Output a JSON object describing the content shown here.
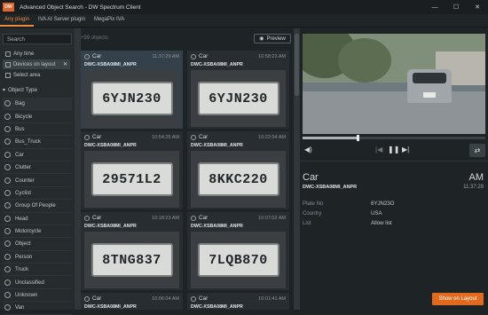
{
  "window": {
    "logo_text": "DW",
    "title": "Advanced Object Search - DW Spectrum Client",
    "controls": [
      "—",
      "☐",
      "✕"
    ]
  },
  "tabs": [
    {
      "label": "Any plugin",
      "active": true
    },
    {
      "label": "IVA AI Server plugin",
      "active": false
    },
    {
      "label": "MegaPix IVA",
      "active": false
    }
  ],
  "left": {
    "search_placeholder": "Search",
    "time_filter": "Any time",
    "camera_filter": "Devices on layout",
    "area_filter": "Select area",
    "section_title": "Object Type",
    "object_types": [
      "Bag",
      "Bicycle",
      "Bus",
      "Bus_Truck",
      "Car",
      "Clutter",
      "Counter",
      "Cyclist",
      "Group Of People",
      "Head",
      "Motorcycle",
      "Object",
      "Person",
      "Truck",
      "Unclassified",
      "Unknown",
      "Van"
    ]
  },
  "middle": {
    "count_text": "+99 objects",
    "preview_label": "Preview",
    "cards": [
      {
        "type": "Car",
        "time": "11:37:29 AM",
        "device": "DWC-XSBA08MI_ANPR",
        "plate": "6YJN230",
        "selected": true
      },
      {
        "type": "Car",
        "time": "10:58:23 AM",
        "device": "DWC-XSBA08MI_ANPR",
        "plate": "6YJN230",
        "selected": false
      },
      {
        "type": "Car",
        "time": "10:54:25 AM",
        "device": "DWC-XSBA08MI_ANPR",
        "plate": "29571L2",
        "selected": false
      },
      {
        "type": "Car",
        "time": "10:22:54 AM",
        "device": "DWC-XSBA08MI_ANPR",
        "plate": "8KKC220",
        "selected": false
      },
      {
        "type": "Car",
        "time": "10:18:23 AM",
        "device": "DWC-XSBA08MI_ANPR",
        "plate": "8TNG837",
        "selected": false
      },
      {
        "type": "Car",
        "time": "10:07:02 AM",
        "device": "DWC-XSBA08MI_ANPR",
        "plate": "7LQB870",
        "selected": false
      },
      {
        "type": "Car",
        "time": "10:06:04 AM",
        "device": "DWC-XSBA08MI_ANPR",
        "plate": "",
        "selected": false
      },
      {
        "type": "Car",
        "time": "10:01:41 AM",
        "device": "DWC-XSBA08MI_ANPR",
        "plate": "",
        "selected": false
      }
    ]
  },
  "right": {
    "object_type": "Car",
    "ampm": "AM",
    "device": "DWC-XSBA08MI_ANPR",
    "time": "11:37:29",
    "attributes": [
      {
        "name": "Plate No",
        "value": "6YJN23O"
      },
      {
        "name": "Country",
        "value": "USA"
      },
      {
        "name": "List",
        "value": "Allow list"
      }
    ],
    "playback_progress": 0.3,
    "show_on_layout_label": "Show on Layout"
  },
  "colors": {
    "accent": "#e26a1e",
    "tab_active": "#f08a3e",
    "background": "#1e2326"
  }
}
